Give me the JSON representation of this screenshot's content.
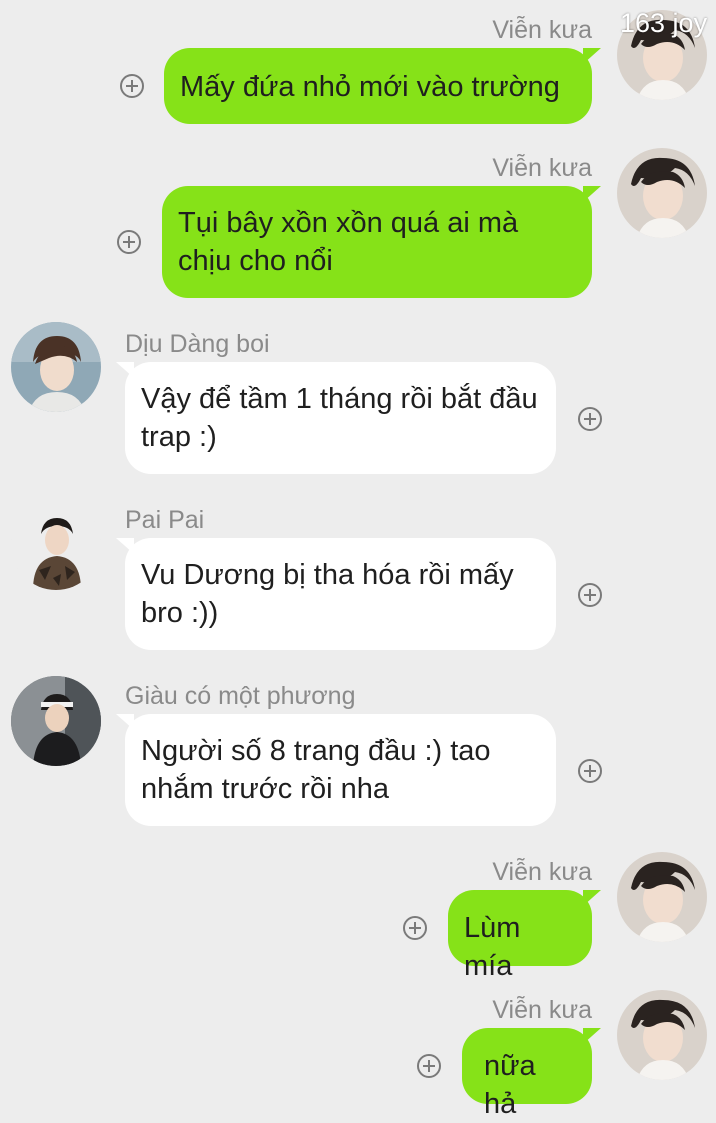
{
  "watermark": "163 joy",
  "messages": [
    {
      "sender": "Viễn kưa",
      "text": "Mấy đứa nhỏ mới vào trường",
      "side": "out"
    },
    {
      "sender": "Viễn kưa",
      "text": "Tụi bây xồn xồn quá ai mà chịu cho nổi",
      "side": "out"
    },
    {
      "sender": "Dịu Dàng boi",
      "text": "Vậy để tầm 1 tháng rồi bắt đầu trap :)",
      "side": "in"
    },
    {
      "sender": "Pai Pai",
      "text": "Vu Dương bị tha hóa rồi mấy bro :))",
      "side": "in"
    },
    {
      "sender": "Giàu có một phương",
      "text": "Người số 8 trang đầu :) tao nhắm trước rồi nha",
      "side": "in"
    },
    {
      "sender": "Viễn kưa",
      "text": "Lùm mía",
      "side": "out"
    },
    {
      "sender": "Viễn kưa",
      "text": "nữa hả",
      "side": "out"
    }
  ],
  "colors": {
    "background": "#ededed",
    "outgoing_bubble": "#86e218",
    "incoming_bubble": "#ffffff",
    "sender_text": "#8a8a8a"
  }
}
